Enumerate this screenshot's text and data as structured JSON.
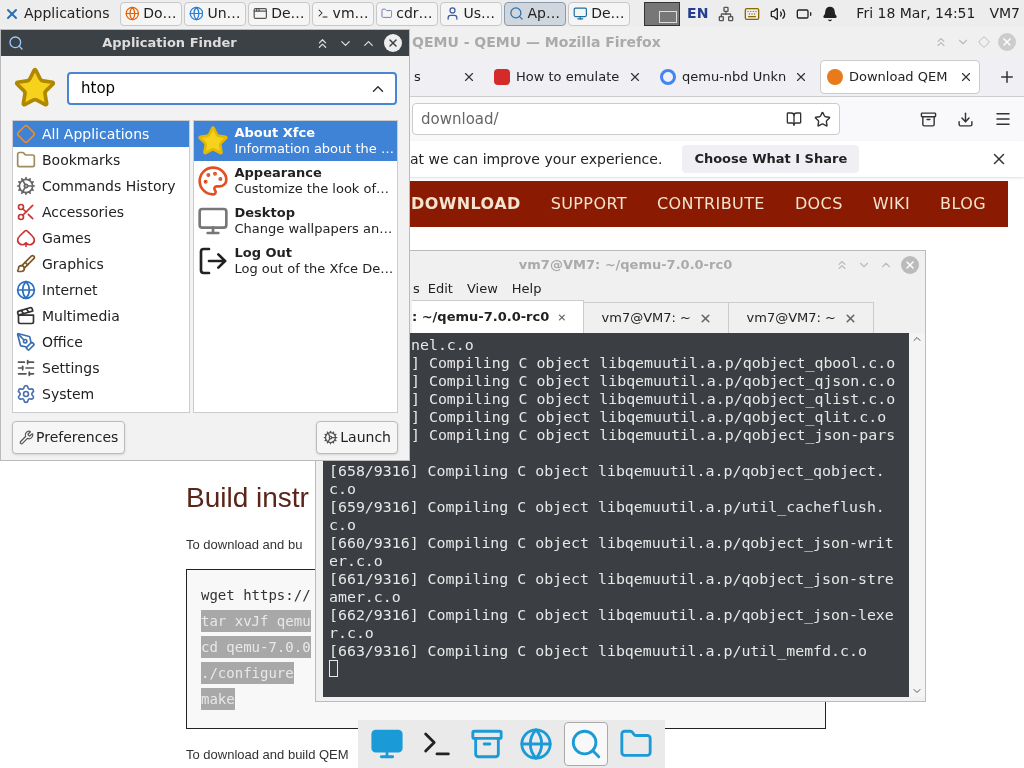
{
  "panel": {
    "menu_label": "Applications",
    "tasks": [
      {
        "label": "Do…",
        "selected": false
      },
      {
        "label": "Un…",
        "selected": false
      },
      {
        "label": "De…",
        "selected": false
      },
      {
        "label": "vm…",
        "selected": false
      },
      {
        "label": "cdr…",
        "selected": false
      },
      {
        "label": "Us…",
        "selected": false
      },
      {
        "label": "Ap…",
        "selected": true
      },
      {
        "label": "De…",
        "selected": false
      }
    ],
    "language": "EN",
    "clock": "Fri 18 Mar, 14:51",
    "user": "VM7"
  },
  "app_finder": {
    "title": "Application Finder",
    "search": {
      "value": "htop"
    },
    "categories": [
      {
        "label": "All Applications",
        "selected": true
      },
      {
        "label": "Bookmarks",
        "selected": false
      },
      {
        "label": "Commands History",
        "selected": false
      },
      {
        "label": "Accessories",
        "selected": false
      },
      {
        "label": "Games",
        "selected": false
      },
      {
        "label": "Graphics",
        "selected": false
      },
      {
        "label": "Internet",
        "selected": false
      },
      {
        "label": "Multimedia",
        "selected": false
      },
      {
        "label": "Office",
        "selected": false
      },
      {
        "label": "Settings",
        "selected": false
      },
      {
        "label": "System",
        "selected": false
      }
    ],
    "results": [
      {
        "name": "About Xfce",
        "description": "Information about the …",
        "selected": true
      },
      {
        "name": "Appearance",
        "description": "Customize the look of…",
        "selected": false
      },
      {
        "name": "Desktop",
        "description": "Change wallpapers an…",
        "selected": false
      },
      {
        "name": "Log Out",
        "description": "Log out of the Xfce De…",
        "selected": false
      }
    ],
    "buttons": [
      "Preferences",
      "Launch"
    ]
  },
  "browser": {
    "title": "QEMU - QEMU — Mozilla Firefox",
    "tabs": [
      {
        "label": "s",
        "selected": false
      },
      {
        "label": "How to emulate",
        "selected": false
      },
      {
        "label": "qemu-nbd Unkn",
        "selected": false
      },
      {
        "label": "Download QEM",
        "selected": true
      }
    ],
    "url": "download/",
    "notice": {
      "text": "at we can improve your experience.",
      "button": "Choose What I Share"
    },
    "nav": [
      "DOWNLOAD",
      "SUPPORT",
      "CONTRIBUTE",
      "DOCS",
      "WIKI",
      "BLOG"
    ],
    "page": {
      "heading": "Build instr",
      "intro": "To download and bu",
      "code": [
        {
          "text": "wget https://",
          "highlighted": false
        },
        {
          "text": "tar xvJf qemu",
          "highlighted": true
        },
        {
          "text": "cd qemu-7.0.0",
          "highlighted": true
        },
        {
          "text": "./configure",
          "highlighted": true
        },
        {
          "text": "make",
          "highlighted": true
        }
      ],
      "footer": "To download and build QEM"
    }
  },
  "terminal": {
    "title": "vm7@VM7: ~/qemu-7.0.0-rc0",
    "menu": [
      "s",
      "Edit",
      "View",
      "Help"
    ],
    "tabs": [
      {
        "label": ": ~/qemu-7.0.0-rc0",
        "selected": true
      },
      {
        "label": "vm7@VM7: ~",
        "selected": false
      },
      {
        "label": "vm7@VM7: ~",
        "selected": false
      }
    ],
    "lines": [
      {
        "text": "nel.c.o",
        "clipped": true
      },
      {
        "text": "] Compiling C object libqemuutil.a.p/qobject_qbool.c.o",
        "clipped": true
      },
      {
        "text": "] Compiling C object libqemuutil.a.p/qobject_qjson.c.o",
        "clipped": true
      },
      {
        "text": "] Compiling C object libqemuutil.a.p/qobject_qlist.c.o",
        "clipped": true
      },
      {
        "text": "] Compiling C object libqemuutil.a.p/qobject_qlit.c.o",
        "clipped": true
      },
      {
        "text": "] Compiling C object libqemuutil.a.p/qobject_json-pars",
        "clipped": true
      },
      {
        "text": "[658/9316] Compiling C object libqemuutil.a.p/qobject_qobject.c.o",
        "clipped": false
      },
      {
        "text": "[659/9316] Compiling C object libqemuutil.a.p/util_cacheflush.c.o",
        "clipped": false
      },
      {
        "text": "[660/9316] Compiling C object libqemuutil.a.p/qobject_json-writer.c.o",
        "clipped": false
      },
      {
        "text": "[661/9316] Compiling C object libqemuutil.a.p/qobject_json-streamer.c.o",
        "clipped": false
      },
      {
        "text": "[662/9316] Compiling C object libqemuutil.a.p/qobject_json-lexer.c.o",
        "clipped": false
      },
      {
        "text": "[663/9316] Compiling C object libqemuutil.a.p/util_memfd.c.o",
        "clipped": false
      }
    ]
  },
  "dock": {
    "items": [
      {
        "selected": false
      },
      {
        "selected": false
      },
      {
        "selected": false
      },
      {
        "selected": false
      },
      {
        "selected": true
      },
      {
        "selected": false
      }
    ]
  }
}
